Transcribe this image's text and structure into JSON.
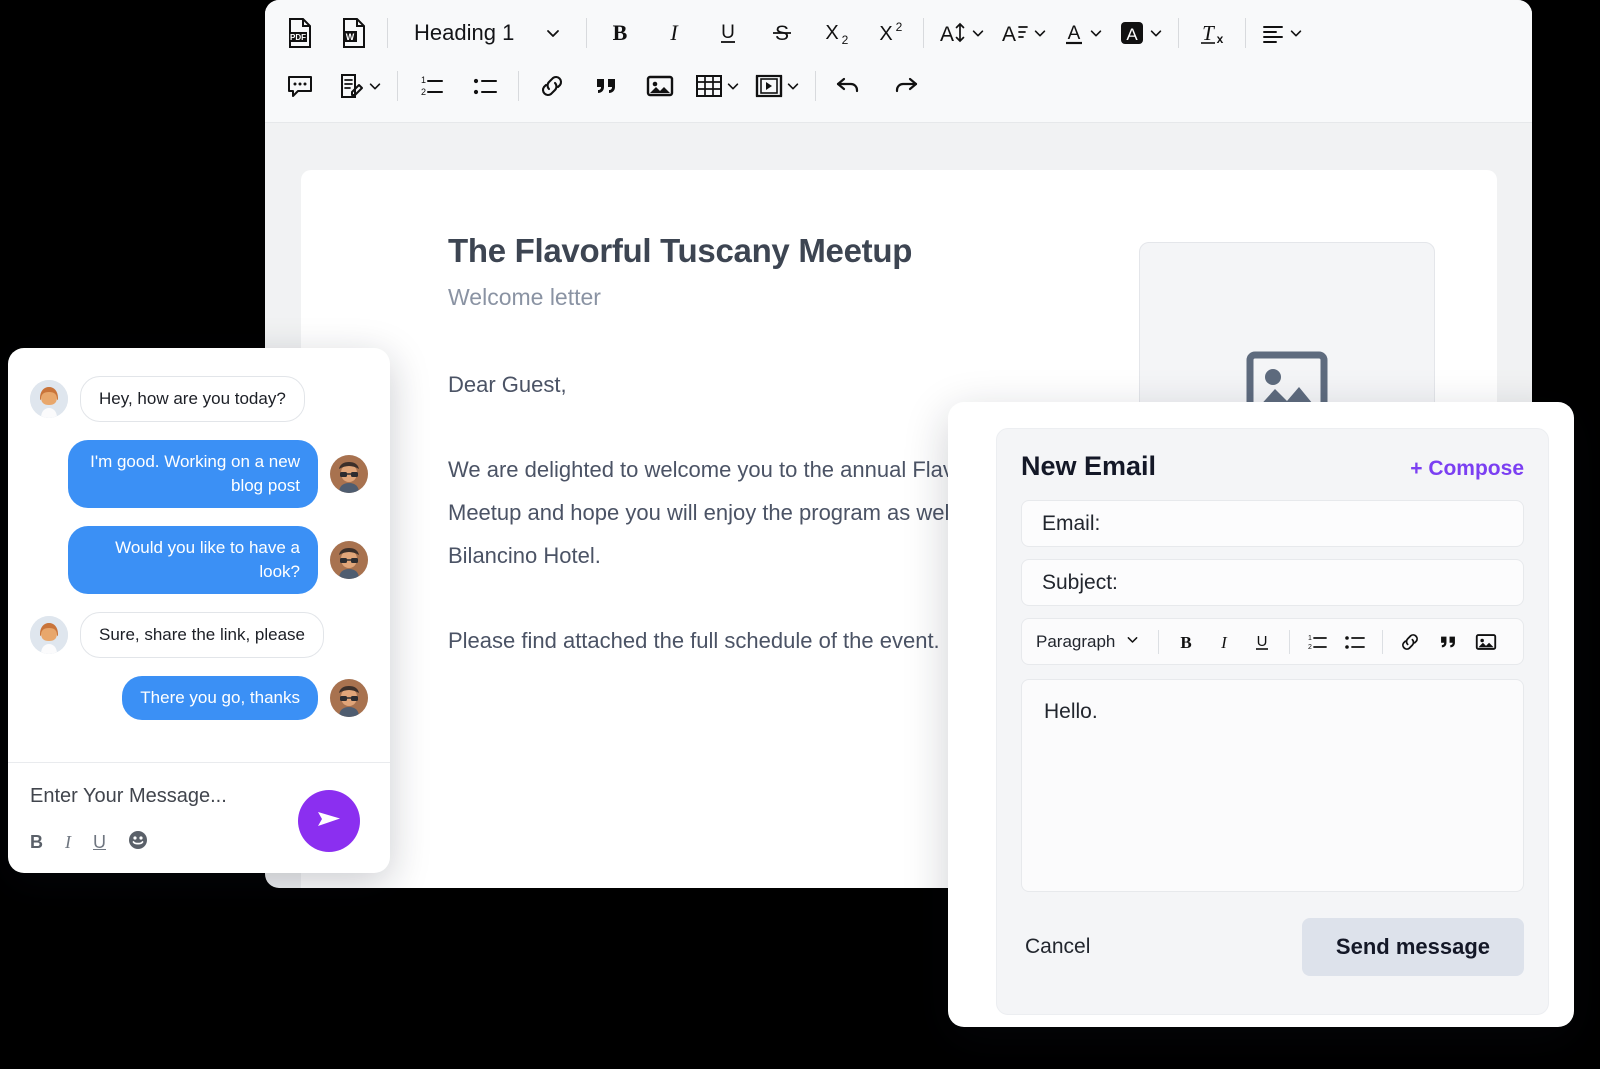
{
  "editor": {
    "toolbar": {
      "row1": [
        {
          "name": "export-pdf-button",
          "icon": "pdf-file-icon",
          "label": "PDF"
        },
        {
          "name": "export-word-button",
          "icon": "word-file-icon",
          "label": "W"
        },
        {
          "name": "paragraph-style-select",
          "icon": "chevron-down-icon",
          "label": "Heading 1"
        },
        {
          "name": "bold-button",
          "icon": "bold-icon",
          "label": "B"
        },
        {
          "name": "italic-button",
          "icon": "italic-icon",
          "label": "I"
        },
        {
          "name": "underline-button",
          "icon": "underline-icon",
          "label": "U"
        },
        {
          "name": "strikethrough-button",
          "icon": "strikethrough-icon",
          "label": "S"
        },
        {
          "name": "subscript-button",
          "icon": "subscript-icon",
          "label": "X2"
        },
        {
          "name": "superscript-button",
          "icon": "superscript-icon",
          "label": "X2"
        },
        {
          "name": "line-height-button",
          "icon": "line-height-icon",
          "label": "A"
        },
        {
          "name": "font-size-button",
          "icon": "font-size-icon",
          "label": "A"
        },
        {
          "name": "text-color-button",
          "icon": "text-color-icon",
          "label": "A"
        },
        {
          "name": "highlight-color-button",
          "icon": "highlight-color-icon",
          "label": "A"
        },
        {
          "name": "clear-formatting-button",
          "icon": "clear-format-icon",
          "label": "Tx"
        },
        {
          "name": "align-button",
          "icon": "align-left-icon",
          "label": ""
        }
      ],
      "row2": [
        {
          "name": "comment-button",
          "icon": "comment-icon",
          "label": ""
        },
        {
          "name": "track-changes-button",
          "icon": "document-edit-icon",
          "label": ""
        },
        {
          "name": "ordered-list-button",
          "icon": "ordered-list-icon",
          "label": ""
        },
        {
          "name": "unordered-list-button",
          "icon": "bullet-list-icon",
          "label": ""
        },
        {
          "name": "insert-link-button",
          "icon": "link-icon",
          "label": ""
        },
        {
          "name": "blockquote-button",
          "icon": "quote-icon",
          "label": ""
        },
        {
          "name": "insert-image-button",
          "icon": "image-icon",
          "label": ""
        },
        {
          "name": "insert-table-button",
          "icon": "table-icon",
          "label": ""
        },
        {
          "name": "insert-video-button",
          "icon": "video-icon",
          "label": ""
        },
        {
          "name": "undo-button",
          "icon": "undo-icon",
          "label": ""
        },
        {
          "name": "redo-button",
          "icon": "redo-icon",
          "label": ""
        }
      ],
      "style_value": "Heading 1"
    },
    "document": {
      "title": "The Flavorful Tuscany Meetup",
      "subtitle": "Welcome letter",
      "salutation": "Dear Guest,",
      "paragraph_1": "We are delighted to welcome you to the annual Flavorful Tuscany Meetup and hope you will enjoy the program as well as your stay at the Bilancino Hotel.",
      "paragraph_2": "Please find attached the full schedule of the event.",
      "image_placeholder_icon": "image-placeholder-icon"
    }
  },
  "chat": {
    "messages": [
      {
        "side": "left",
        "text": "Hey, how are you today?",
        "avatar": "avatar-woman"
      },
      {
        "side": "right",
        "text": "I'm good. Working on a new blog post",
        "avatar": "avatar-man"
      },
      {
        "side": "right",
        "text": "Would you like to have a look?",
        "avatar": "avatar-man"
      },
      {
        "side": "left",
        "text": "Sure, share the link, please",
        "avatar": "avatar-woman"
      },
      {
        "side": "right",
        "text": "There you go, thanks",
        "avatar": "avatar-man"
      }
    ],
    "input_placeholder": "Enter Your Message...",
    "format_buttons": [
      {
        "name": "chat-bold-button",
        "label": "B"
      },
      {
        "name": "chat-italic-button",
        "label": "I"
      },
      {
        "name": "chat-underline-button",
        "label": "U"
      },
      {
        "name": "chat-emoji-button",
        "label": "☺"
      }
    ],
    "send_icon": "send-paper-plane-icon",
    "colors": {
      "outgoing_bubble": "#3b90f5",
      "send_button": "#8b2ff0"
    }
  },
  "email": {
    "title": "New Email",
    "compose_label": "+ Compose",
    "fields": [
      {
        "name": "email-address-field",
        "value": "Email:"
      },
      {
        "name": "email-subject-field",
        "value": "Subject:"
      }
    ],
    "mini_toolbar": {
      "style_value": "Paragraph",
      "buttons": [
        {
          "name": "email-bold-button",
          "icon": "bold-icon"
        },
        {
          "name": "email-italic-button",
          "icon": "italic-icon"
        },
        {
          "name": "email-underline-button",
          "icon": "underline-icon"
        },
        {
          "name": "email-ordered-list-button",
          "icon": "ordered-list-icon"
        },
        {
          "name": "email-bullet-list-button",
          "icon": "bullet-list-icon"
        },
        {
          "name": "email-link-button",
          "icon": "link-icon"
        },
        {
          "name": "email-quote-button",
          "icon": "quote-icon"
        },
        {
          "name": "email-image-button",
          "icon": "image-icon"
        }
      ]
    },
    "body_text": "Hello.",
    "cancel_label": "Cancel",
    "send_label": "Send message",
    "colors": {
      "compose_link": "#7b3ff2",
      "send_button_bg": "#dde2eb"
    }
  }
}
